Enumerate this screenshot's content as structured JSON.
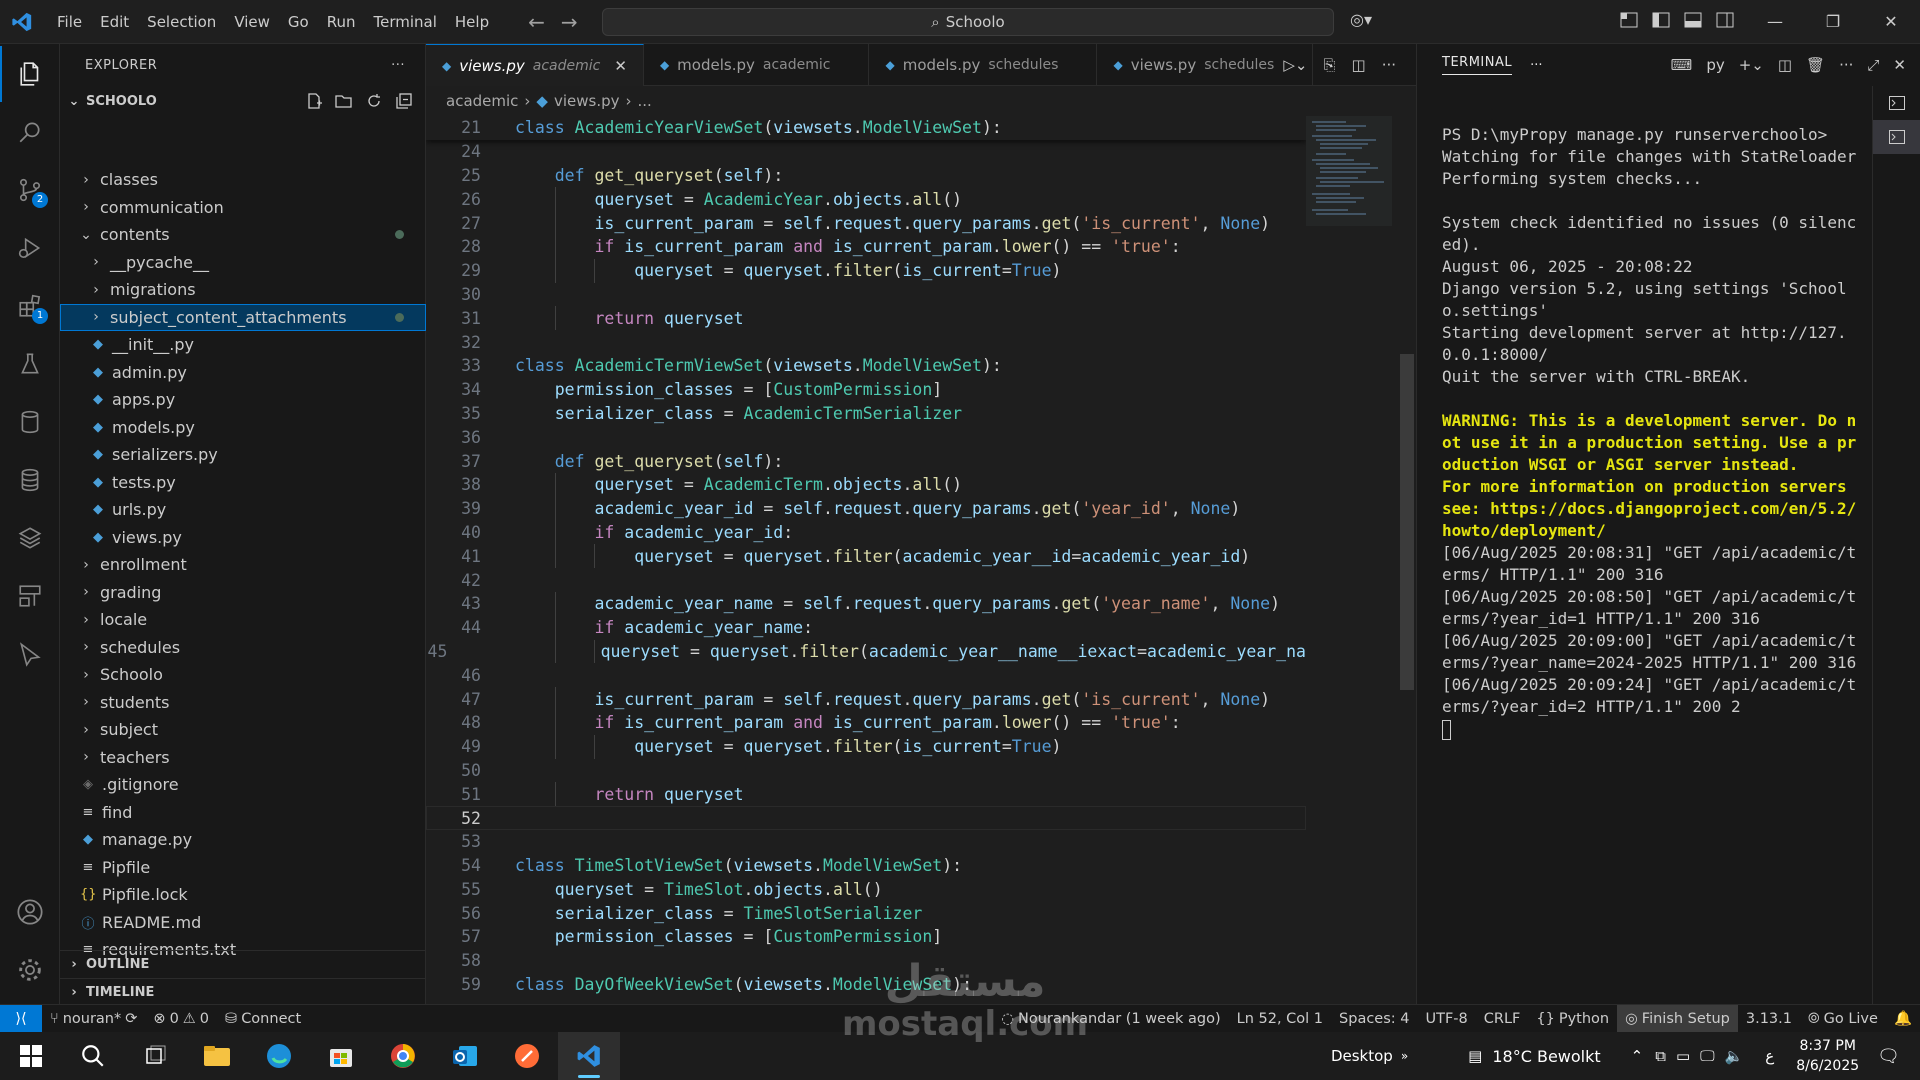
{
  "titlebar": {
    "menus": [
      "File",
      "Edit",
      "Selection",
      "View",
      "Go",
      "Run",
      "Terminal",
      "Help"
    ],
    "search_text": "Schoolo"
  },
  "activity": {
    "scm_badge": "2",
    "ext_badge": "1"
  },
  "sidebar": {
    "title": "EXPLORER",
    "workspace": "SCHOOLO",
    "tree": [
      {
        "label": "classes",
        "depth": 0,
        "type": "folder",
        "open": false
      },
      {
        "label": "communication",
        "depth": 0,
        "type": "folder",
        "open": false
      },
      {
        "label": "contents",
        "depth": 0,
        "type": "folder",
        "open": true,
        "modified": true
      },
      {
        "label": "__pycache__",
        "depth": 1,
        "type": "folder",
        "open": false
      },
      {
        "label": "migrations",
        "depth": 1,
        "type": "folder",
        "open": false
      },
      {
        "label": "subject_content_attachments",
        "depth": 1,
        "type": "folder",
        "open": false,
        "selected": true,
        "modified": true
      },
      {
        "label": "__init__.py",
        "depth": 1,
        "type": "py"
      },
      {
        "label": "admin.py",
        "depth": 1,
        "type": "py"
      },
      {
        "label": "apps.py",
        "depth": 1,
        "type": "py"
      },
      {
        "label": "models.py",
        "depth": 1,
        "type": "py"
      },
      {
        "label": "serializers.py",
        "depth": 1,
        "type": "py"
      },
      {
        "label": "tests.py",
        "depth": 1,
        "type": "py"
      },
      {
        "label": "urls.py",
        "depth": 1,
        "type": "py"
      },
      {
        "label": "views.py",
        "depth": 1,
        "type": "py"
      },
      {
        "label": "enrollment",
        "depth": 0,
        "type": "folder",
        "open": false
      },
      {
        "label": "grading",
        "depth": 0,
        "type": "folder",
        "open": false
      },
      {
        "label": "locale",
        "depth": 0,
        "type": "folder",
        "open": false
      },
      {
        "label": "schedules",
        "depth": 0,
        "type": "folder",
        "open": false
      },
      {
        "label": "Schoolo",
        "depth": 0,
        "type": "folder",
        "open": false
      },
      {
        "label": "students",
        "depth": 0,
        "type": "folder",
        "open": false
      },
      {
        "label": "subject",
        "depth": 0,
        "type": "folder",
        "open": false
      },
      {
        "label": "teachers",
        "depth": 0,
        "type": "folder",
        "open": false
      },
      {
        "label": ".gitignore",
        "depth": 0,
        "type": "git"
      },
      {
        "label": "find",
        "depth": 0,
        "type": "txt"
      },
      {
        "label": "manage.py",
        "depth": 0,
        "type": "py"
      },
      {
        "label": "Pipfile",
        "depth": 0,
        "type": "txt"
      },
      {
        "label": "Pipfile.lock",
        "depth": 0,
        "type": "json"
      },
      {
        "label": "README.md",
        "depth": 0,
        "type": "info"
      },
      {
        "label": "requirements.txt",
        "depth": 0,
        "type": "txt"
      }
    ],
    "outline": "OUTLINE",
    "timeline": "TIMELINE"
  },
  "tabs": [
    {
      "name": "views.py",
      "desc": "academic",
      "active": true
    },
    {
      "name": "models.py",
      "desc": "academic",
      "active": false
    },
    {
      "name": "models.py",
      "desc": "schedules",
      "active": false
    },
    {
      "name": "views.py",
      "desc": "schedules",
      "active": false
    }
  ],
  "breadcrumb": {
    "folder": "academic",
    "file": "views.py",
    "more": "..."
  },
  "code": [
    {
      "n": "21",
      "t": "class AcademicYearViewSet(viewsets.ModelViewSet):",
      "sticky": true
    },
    {
      "n": "24",
      "t": ""
    },
    {
      "n": "25",
      "t": "    def get_queryset(self):"
    },
    {
      "n": "26",
      "t": "        queryset = AcademicYear.objects.all()"
    },
    {
      "n": "27",
      "t": "        is_current_param = self.request.query_params.get('is_current', None)"
    },
    {
      "n": "28",
      "t": "        if is_current_param and is_current_param.lower() == 'true':"
    },
    {
      "n": "29",
      "t": "            queryset = queryset.filter(is_current=True)"
    },
    {
      "n": "30",
      "t": ""
    },
    {
      "n": "31",
      "t": "        return queryset"
    },
    {
      "n": "32",
      "t": ""
    },
    {
      "n": "33",
      "t": "class AcademicTermViewSet(viewsets.ModelViewSet):"
    },
    {
      "n": "34",
      "t": "    permission_classes = [CustomPermission]"
    },
    {
      "n": "35",
      "t": "    serializer_class = AcademicTermSerializer"
    },
    {
      "n": "36",
      "t": ""
    },
    {
      "n": "37",
      "t": "    def get_queryset(self):"
    },
    {
      "n": "38",
      "t": "        queryset = AcademicTerm.objects.all()"
    },
    {
      "n": "39",
      "t": "        academic_year_id = self.request.query_params.get('year_id', None)"
    },
    {
      "n": "40",
      "t": "        if academic_year_id:"
    },
    {
      "n": "41",
      "t": "            queryset = queryset.filter(academic_year__id=academic_year_id)"
    },
    {
      "n": "42",
      "t": ""
    },
    {
      "n": "43",
      "t": "        academic_year_name = self.request.query_params.get('year_name', None)"
    },
    {
      "n": "44",
      "t": "        if academic_year_name:"
    },
    {
      "n": "45",
      "t": "            queryset = queryset.filter(academic_year__name__iexact=academic_year_na"
    },
    {
      "n": "46",
      "t": ""
    },
    {
      "n": "47",
      "t": "        is_current_param = self.request.query_params.get('is_current', None)"
    },
    {
      "n": "48",
      "t": "        if is_current_param and is_current_param.lower() == 'true':"
    },
    {
      "n": "49",
      "t": "            queryset = queryset.filter(is_current=True)"
    },
    {
      "n": "50",
      "t": ""
    },
    {
      "n": "51",
      "t": "        return queryset"
    },
    {
      "n": "52",
      "t": "",
      "current": true
    },
    {
      "n": "53",
      "t": ""
    },
    {
      "n": "54",
      "t": "class TimeSlotViewSet(viewsets.ModelViewSet):"
    },
    {
      "n": "55",
      "t": "    queryset = TimeSlot.objects.all()"
    },
    {
      "n": "56",
      "t": "    serializer_class = TimeSlotSerializer"
    },
    {
      "n": "57",
      "t": "    permission_classes = [CustomPermission]"
    },
    {
      "n": "58",
      "t": ""
    },
    {
      "n": "59",
      "t": "class DayOfWeekViewSet(viewsets.ModelViewSet):"
    }
  ],
  "terminal": {
    "title": "TERMINAL",
    "shell": "py",
    "lines": [
      {
        "t": "PS D:\\myPropy manage.py runserverchoolo>",
        "style": "normal"
      },
      {
        "t": "Watching for file changes with StatReloader",
        "style": "normal"
      },
      {
        "t": "Performing system checks...",
        "style": "normal"
      },
      {
        "t": "",
        "style": "normal"
      },
      {
        "t": "System check identified no issues (0 silenced).",
        "style": "normal"
      },
      {
        "t": "August 06, 2025 - 20:08:22",
        "style": "normal"
      },
      {
        "t": "Django version 5.2, using settings 'Schoolo.settings'",
        "style": "normal"
      },
      {
        "t": "Starting development server at http://127.0.0.1:8000/",
        "style": "normal"
      },
      {
        "t": "Quit the server with CTRL-BREAK.",
        "style": "normal"
      },
      {
        "t": "",
        "style": "normal"
      },
      {
        "t": "WARNING: This is a development server. Do not use it in a production setting. Use a production WSGI or ASGI server instead.",
        "style": "warn"
      },
      {
        "t": "For more information on production servers see: https://docs.djangoproject.com/en/5.2/howto/deployment/",
        "style": "warn"
      },
      {
        "t": "[06/Aug/2025 20:08:31] \"GET /api/academic/terms/ HTTP/1.1\" 200 316",
        "style": "normal"
      },
      {
        "t": "[06/Aug/2025 20:08:50] \"GET /api/academic/terms/?year_id=1 HTTP/1.1\" 200 316",
        "style": "normal"
      },
      {
        "t": "[06/Aug/2025 20:09:00] \"GET /api/academic/terms/?year_name=2024-2025 HTTP/1.1\" 200 316",
        "style": "normal"
      },
      {
        "t": "[06/Aug/2025 20:09:24] \"GET /api/academic/terms/?year_id=2 HTTP/1.1\" 200 2",
        "style": "normal"
      }
    ]
  },
  "status": {
    "branch": "nouran*",
    "errors": "0",
    "warnings": "0",
    "connect": "Connect",
    "blame": "Nourankandar (1 week ago)",
    "position": "Ln 52, Col 1",
    "spaces": "Spaces: 4",
    "encoding": "UTF-8",
    "eol": "CRLF",
    "language": "Python",
    "finish_setup": "Finish Setup",
    "version": "3.13.1",
    "golive": "Go Live"
  },
  "taskbar": {
    "desktop": "Desktop",
    "weather": "18°C  Bewolkt",
    "lang": "ع",
    "time": "8:37 PM",
    "date": "8/6/2025"
  },
  "watermark": {
    "arabic": "مستقل",
    "latin": "mostaql.com"
  }
}
